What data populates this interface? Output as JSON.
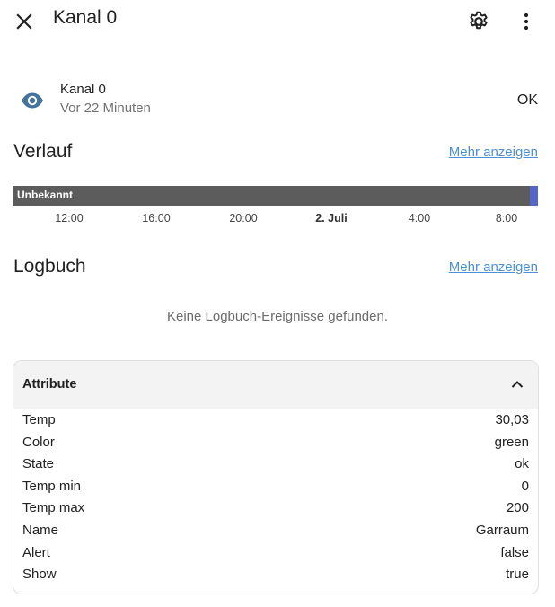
{
  "header": {
    "title": "Kanal 0",
    "close_icon": "close-icon",
    "settings_icon": "gear-icon",
    "more_icon": "more-vertical-icon"
  },
  "entity": {
    "icon": "eye-icon",
    "icon_color": "#44739e",
    "name": "Kanal 0",
    "last_changed": "Vor 22 Minuten",
    "state": "OK"
  },
  "history": {
    "title": "Verlauf",
    "more_link": "Mehr anzeigen",
    "segments": [
      {
        "label": "Unbekannt",
        "color": "#5c5c5c"
      },
      {
        "label": "",
        "color": "#5465c8"
      }
    ],
    "ticks": [
      "12:00",
      "16:00",
      "20:00",
      "2. Juli",
      "4:00",
      "8:00"
    ]
  },
  "logbook": {
    "title": "Logbuch",
    "more_link": "Mehr anzeigen",
    "empty_text": "Keine Logbuch-Ereignisse gefunden."
  },
  "attributes": {
    "title": "Attribute",
    "rows": [
      {
        "key": "Temp",
        "value": "30,03"
      },
      {
        "key": "Color",
        "value": "green"
      },
      {
        "key": "State",
        "value": "ok"
      },
      {
        "key": "Temp min",
        "value": "0"
      },
      {
        "key": "Temp max",
        "value": "200"
      },
      {
        "key": "Name",
        "value": "Garraum"
      },
      {
        "key": "Alert",
        "value": "false"
      },
      {
        "key": "Show",
        "value": "true"
      }
    ]
  },
  "colors": {
    "link": "#4d90d7",
    "timeline_unknown": "#5c5c5c",
    "timeline_current": "#5465c8"
  }
}
